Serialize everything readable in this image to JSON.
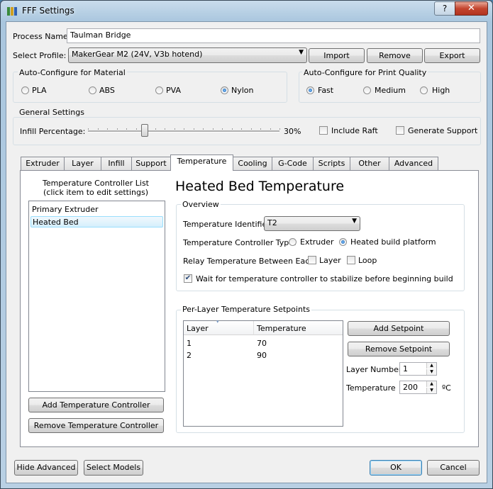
{
  "window": {
    "title": "FFF Settings",
    "help_label": "?",
    "close_label": "✕"
  },
  "process": {
    "name_label": "Process Name:",
    "name_value": "Taulman Bridge",
    "profile_label": "Select Profile:",
    "profile_value": "MakerGear M2 (24V, V3b hotend)"
  },
  "profile_buttons": {
    "import": "Import",
    "remove": "Remove",
    "export": "Export"
  },
  "material": {
    "title": "Auto-Configure for Material",
    "options": [
      "PLA",
      "ABS",
      "PVA",
      "Nylon"
    ],
    "selected": "Nylon"
  },
  "quality": {
    "title": "Auto-Configure for Print Quality",
    "options": [
      "Fast",
      "Medium",
      "High"
    ],
    "selected": "Fast"
  },
  "general": {
    "title": "General Settings",
    "infill_label": "Infill Percentage:",
    "infill_value": "30%",
    "infill_fraction": 0.3,
    "raft_label": "Include Raft",
    "support_label": "Generate Support"
  },
  "tabs": [
    "Extruder",
    "Layer",
    "Infill",
    "Support",
    "Temperature",
    "Cooling",
    "G-Code",
    "Scripts",
    "Other",
    "Advanced"
  ],
  "active_tab": "Temperature",
  "controller_list": {
    "title_line1": "Temperature Controller List",
    "title_line2": "(click item to edit settings)",
    "items": [
      "Primary Extruder",
      "Heated Bed"
    ],
    "selected": "Heated Bed",
    "add_button": "Add Temperature Controller",
    "remove_button": "Remove Temperature Controller"
  },
  "heading": "Heated Bed Temperature",
  "overview": {
    "title": "Overview",
    "identifier_label": "Temperature Identifier",
    "identifier_value": "T2",
    "controller_type_label": "Temperature Controller Type:",
    "type_extruder": "Extruder",
    "type_platform": "Heated build platform",
    "relay_label": "Relay Temperature Between Each:",
    "relay_layer": "Layer",
    "relay_loop": "Loop",
    "wait_label": "Wait for temperature controller to stabilize before beginning build",
    "wait_checked": true
  },
  "setpoints": {
    "title": "Per-Layer Temperature Setpoints",
    "col_layer": "Layer",
    "col_temp": "Temperature",
    "rows": [
      {
        "layer": "1",
        "temp": "70"
      },
      {
        "layer": "2",
        "temp": "90"
      }
    ],
    "add_button": "Add Setpoint",
    "remove_button": "Remove Setpoint",
    "layer_number_label": "Layer Number",
    "layer_number_value": "1",
    "temperature_label": "Temperature",
    "temperature_value": "200",
    "unit": "ºC"
  },
  "footer": {
    "hide_advanced": "Hide Advanced",
    "select_models": "Select Models",
    "ok": "OK",
    "cancel": "Cancel"
  }
}
